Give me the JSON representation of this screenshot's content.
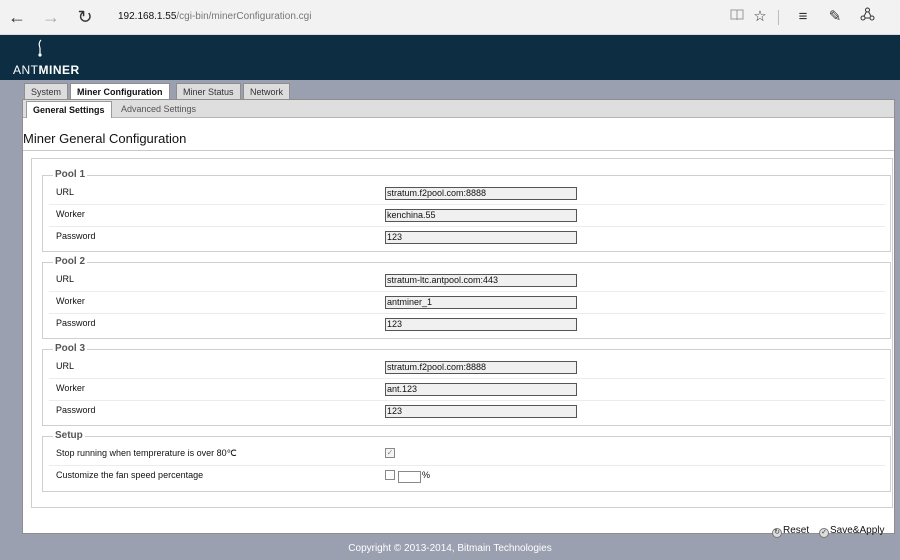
{
  "browser": {
    "url_host": "192.168.1.55",
    "url_path": "/cgi-bin/minerConfiguration.cgi",
    "icons": [
      "back-icon",
      "forward-icon",
      "refresh-icon",
      "reading-view-icon",
      "favorite-star-icon",
      "hub-icon",
      "web-note-icon",
      "share-icon"
    ]
  },
  "app": {
    "logo_prefix": "ANT",
    "logo_bold": "MINER"
  },
  "tabs": [
    "System",
    "Miner Configuration",
    "Miner Status",
    "Network"
  ],
  "active_tab": "Miner Configuration",
  "subtabs": [
    "General Settings",
    "Advanced Settings"
  ],
  "active_subtab": "General Settings",
  "page_title": "Miner General Configuration",
  "pools": [
    {
      "title": "Pool 1",
      "url_label": "URL",
      "url": "stratum.f2pool.com:8888",
      "worker_label": "Worker",
      "worker": "kenchina.55",
      "password_label": "Password",
      "password": "123"
    },
    {
      "title": "Pool 2",
      "url_label": "URL",
      "url": "stratum-ltc.antpool.com:443",
      "worker_label": "Worker",
      "worker": "antminer_1",
      "password_label": "Password",
      "password": "123"
    },
    {
      "title": "Pool 3",
      "url_label": "URL",
      "url": "stratum.f2pool.com:8888",
      "worker_label": "Worker",
      "worker": "ant.123",
      "password_label": "Password",
      "password": "123"
    }
  ],
  "setup": {
    "title": "Setup",
    "stop_label": "Stop running when temprerature is over 80℃",
    "stop_checked": true,
    "fan_label": "Customize the fan speed percentage",
    "fan_checked": false,
    "fan_value": "",
    "fan_unit": "%"
  },
  "buttons": {
    "reset": "Reset",
    "save": "Save&Apply"
  },
  "footer": "Copyright © 2013-2014, Bitmain Technologies",
  "colors": {
    "header_bg": "#0c2d42",
    "page_bg": "#9ba0b1",
    "panel_bg": "#ffffff"
  }
}
